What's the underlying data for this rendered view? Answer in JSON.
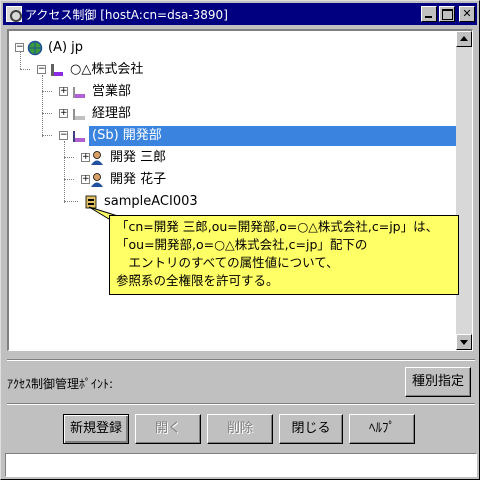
{
  "window": {
    "title": "アクセス制御 [hostA:cn=dsa-3890]"
  },
  "tree": {
    "nodes": [
      {
        "label": "(A) jp",
        "icon": "globe-icon"
      },
      {
        "label": "○△株式会社",
        "icon": "organization-icon"
      },
      {
        "label": "営業部",
        "icon": "org-unit-icon"
      },
      {
        "label": "経理部",
        "icon": "org-unit-icon"
      },
      {
        "label": "(Sb) 開発部",
        "icon": "org-unit-icon",
        "selected": true
      },
      {
        "label": "開発 三郎",
        "icon": "person-icon"
      },
      {
        "label": "開発 花子",
        "icon": "person-icon"
      },
      {
        "label": "sampleACI003",
        "icon": "aci-icon"
      }
    ]
  },
  "tooltip": {
    "line1": "「cn=開発 三郎,ou=開発部,o=○△株式会社,c=jp」は、",
    "line2": "「ou=開発部,o=○△株式会社,c=jp」配下の",
    "line3": "　エントリのすべての属性値について、",
    "line4": "参照系の全権限を許可する。"
  },
  "management_point_label": "ｱｸｾｽ制御管理ﾎﾟｲﾝﾄ:",
  "buttons": {
    "type_spec": "種別指定",
    "new_register": "新規登録",
    "open": "開く",
    "delete": "削除",
    "close": "閉じる",
    "help": "ﾍﾙﾌﾟ"
  },
  "colors": {
    "titlebar": "#000080",
    "selection": "#3a84e0",
    "tooltip_bg": "#ffff66"
  }
}
